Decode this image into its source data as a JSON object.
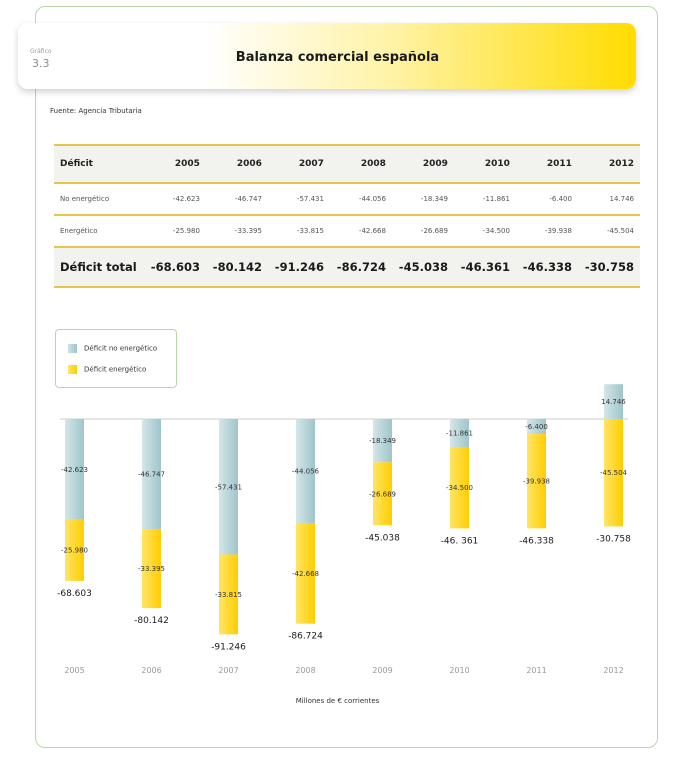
{
  "header": {
    "label": "Gráfico",
    "number": "3.3",
    "title": "Balanza comercial española",
    "source": "Fuente: Agencia Tributaria"
  },
  "table": {
    "corner": "Déficit",
    "years": [
      "2005",
      "2006",
      "2007",
      "2008",
      "2009",
      "2010",
      "2011",
      "2012"
    ],
    "rows": [
      {
        "label": "No energético",
        "values": [
          "-42.623",
          "-46.747",
          "-57.431",
          "-44.056",
          "-18.349",
          "-11.861",
          "-6.400",
          "14.746"
        ]
      },
      {
        "label": "Energético",
        "values": [
          "-25.980",
          "-33.395",
          "-33.815",
          "-42.668",
          "-26.689",
          "-34.500",
          "-39.938",
          "-45.504"
        ]
      }
    ],
    "total": {
      "label": "Déficit total",
      "values": [
        "-68.603",
        "-80.142",
        "-91.246",
        "-86.724",
        "-45.038",
        "-46.361",
        "-46.338",
        "-30.758"
      ]
    }
  },
  "legend": {
    "non_energy": "Déficit no energético",
    "energy": "Déficit energético"
  },
  "colors": {
    "non_energy": "#a9ccd0",
    "energy": "#ffd200",
    "accent_line": "#e6c64a",
    "frame": "#b9d7a6"
  },
  "chart_data": {
    "type": "bar",
    "stacked": true,
    "categories": [
      "2005",
      "2006",
      "2007",
      "2008",
      "2009",
      "2010",
      "2011",
      "2012"
    ],
    "series": [
      {
        "name": "Déficit no energético",
        "values": [
          -42.623,
          -46.747,
          -57.431,
          -44.056,
          -18.349,
          -11.861,
          -6.4,
          14.746
        ],
        "labels": [
          "-42.623",
          "-46.747",
          "-57.431",
          "-44.056",
          "-18.349",
          "-11.861",
          "-6.400",
          "14.746"
        ]
      },
      {
        "name": "Déficit energético",
        "values": [
          -25.98,
          -33.395,
          -33.815,
          -42.668,
          -26.689,
          -34.5,
          -39.938,
          -45.504
        ],
        "labels": [
          "-25.980",
          "-33.395",
          "-33.815",
          "-42.668",
          "-26.689",
          "-34.500",
          "-39.938",
          "-45.504"
        ]
      }
    ],
    "totals": [
      -68.603,
      -80.142,
      -91.246,
      -86.724,
      -45.038,
      -46.361,
      -46.338,
      -30.758
    ],
    "total_labels": [
      "-68.603",
      "-80.142",
      "-91.246",
      "-86.724",
      "-45.038",
      "-46. 361",
      "-46.338",
      "-30.758"
    ],
    "xlabel": "Millones de € corrientes",
    "grid": false,
    "legend_position": "top-left"
  }
}
